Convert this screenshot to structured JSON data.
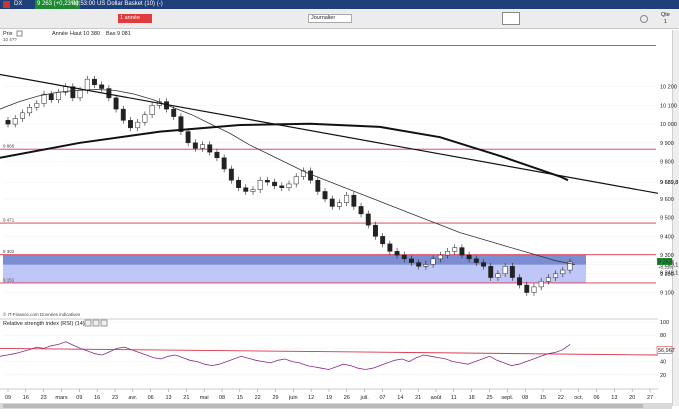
{
  "window": {
    "symbol": "DX",
    "price_badge": "9 263 (+0,23%)",
    "description": "09:53:00 US Dollar Basket (10) (-)"
  },
  "toolbar": {
    "period": "1 année",
    "interval": "Journalier",
    "quote_label": "Qte",
    "quote_value": "1"
  },
  "legend": {
    "prix": "Prix",
    "annee": "Année",
    "haut": "Haut 10 380",
    "bas": "Bas 9 081",
    "first_level": "10 4??"
  },
  "colors": {
    "up_candle": "#ffffff",
    "down_candle": "#222222",
    "level_line": "#d9344a",
    "zone_fill": "#aab3f5",
    "zone_dark": "#6c7ec8",
    "rsi_line": "#8a2a8a",
    "rsi_trend": "#d9344a",
    "price_badge": "#1d8a32"
  },
  "chart_data": [
    {
      "type": "candlestick",
      "title": "",
      "y_ticks": [
        "10 200",
        "10 100",
        "10 000",
        "9 900",
        "9 800",
        "9 689,8",
        "9 600",
        "9 500",
        "9 400",
        "9 300",
        "9 263",
        "9 249,1",
        "9 200",
        "9 100"
      ],
      "ylim": [
        9060,
        10460
      ],
      "x_ticks": [
        "09",
        "16",
        "23",
        "mars",
        "09",
        "16",
        "23",
        "avr.",
        "06",
        "13",
        "21",
        "mai",
        "08",
        "15",
        "22",
        "29",
        "juin",
        "12",
        "19",
        "26",
        "juil.",
        "07",
        "14",
        "21",
        "août",
        "11",
        "18",
        "25",
        "sept.",
        "08",
        "15",
        "22",
        "oct.",
        "06",
        "13",
        "20",
        "27"
      ],
      "levels": [
        {
          "label": "9 866",
          "value": 9866
        },
        {
          "label": "9 471",
          "value": 9471
        },
        {
          "label": "9 302",
          "value": 9302
        },
        {
          "label": "9 151",
          "value": 9151
        }
      ],
      "zone": {
        "from": 9151,
        "to": 9302,
        "dark_from": 9249,
        "dark_to": 9302
      },
      "last_price": "9 263",
      "last_change": "+0,23%",
      "ma_value": "9 249,1",
      "trendline_label": "9 689,8",
      "close_series": [
        10000,
        10030,
        10060,
        10090,
        10110,
        10160,
        10130,
        10170,
        10200,
        10140,
        10180,
        10240,
        10210,
        10190,
        10140,
        10080,
        10020,
        9980,
        10010,
        10050,
        10100,
        10120,
        10080,
        10040,
        9960,
        9900,
        9870,
        9890,
        9850,
        9820,
        9760,
        9700,
        9660,
        9640,
        9650,
        9700,
        9690,
        9670,
        9660,
        9680,
        9720,
        9750,
        9700,
        9640,
        9600,
        9560,
        9580,
        9620,
        9560,
        9520,
        9460,
        9400,
        9360,
        9320,
        9300,
        9280,
        9260,
        9240,
        9250,
        9280,
        9300,
        9320,
        9340,
        9300,
        9280,
        9260,
        9240,
        9180,
        9200,
        9240,
        9180,
        9140,
        9100,
        9130,
        9160,
        9180,
        9200,
        9220,
        9263
      ],
      "ma_series": [
        10080,
        10120,
        10150,
        10170,
        10180,
        10185,
        10180,
        10160,
        10130,
        10090,
        10050,
        10000,
        9950,
        9890,
        9840,
        9790,
        9740,
        9700,
        9660,
        9620,
        9580,
        9540,
        9500,
        9460,
        9420,
        9390,
        9360,
        9330,
        9300,
        9270,
        9249
      ]
    },
    {
      "type": "line",
      "title": "Relative strength index (RSI) (14)",
      "y_ticks": [
        "100",
        "80",
        "60",
        "40",
        "20"
      ],
      "ylim": [
        0,
        100
      ],
      "last_value": "56,967",
      "series": [
        48,
        50,
        52,
        55,
        58,
        62,
        60,
        64,
        66,
        70,
        65,
        60,
        56,
        52,
        50,
        55,
        60,
        62,
        58,
        54,
        50,
        46,
        44,
        48,
        50,
        46,
        42,
        40,
        36,
        34,
        36,
        40,
        44,
        48,
        45,
        42,
        40,
        38,
        42,
        44,
        40,
        38,
        34,
        32,
        30,
        28,
        32,
        36,
        34,
        30,
        28,
        30,
        34,
        38,
        42,
        44,
        40,
        46,
        50,
        48,
        46,
        44,
        40,
        38,
        36,
        40,
        44,
        48,
        42,
        38,
        34,
        36,
        40,
        44,
        48,
        52,
        54,
        58,
        66
      ]
    }
  ],
  "footer": {
    "copyright": "© IT-Finance.com Données indicatives"
  }
}
